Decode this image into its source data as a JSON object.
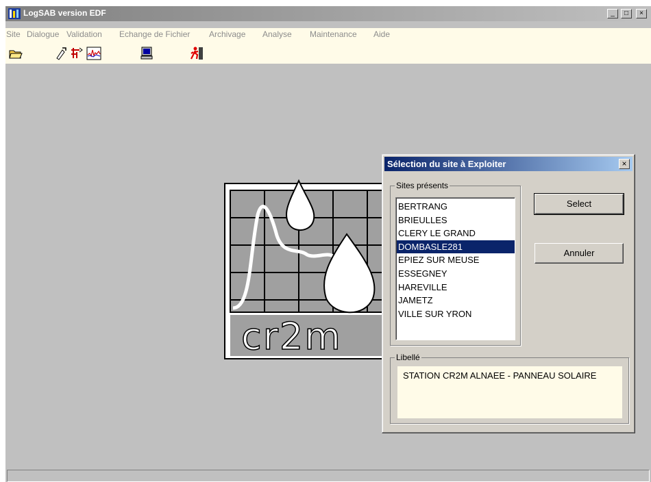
{
  "window": {
    "title": "LogSAB version EDF",
    "minimize_label": "_",
    "maximize_label": "□",
    "close_label": "×"
  },
  "menu": {
    "items": [
      "Site",
      "Dialogue",
      "Validation",
      "Echange de Fichier",
      "Archivage",
      "Analyse",
      "Maintenance",
      "Aide"
    ]
  },
  "toolbar": {
    "buttons": [
      "open-folder-icon",
      "tool-icon",
      "transfer-icon",
      "chart-icon",
      "computer-icon",
      "exit-icon"
    ]
  },
  "logo": {
    "text": "cr2m"
  },
  "dialog": {
    "title": "Sélection du site à Exploiter",
    "close_label": "×",
    "sites_group_label": "Sites présents",
    "sites": [
      "BERTRANG",
      "BRIEULLES",
      "CLERY LE GRAND",
      "DOMBASLE281",
      "EPIEZ SUR MEUSE",
      "ESSEGNEY",
      "HAREVILLE",
      "JAMETZ",
      "VILLE SUR YRON"
    ],
    "selected_site": "DOMBASLE281",
    "select_label": "Select",
    "cancel_label": "Annuler",
    "libelle_group_label": "Libellé",
    "libelle_value": "STATION CR2M ALNAEE - PANNEAU SOLAIRE"
  },
  "colors": {
    "dialog_title_start": "#0a246a",
    "dialog_title_end": "#a6caf0",
    "selection": "#0a246a",
    "menubar_bg": "#fffbe8"
  }
}
